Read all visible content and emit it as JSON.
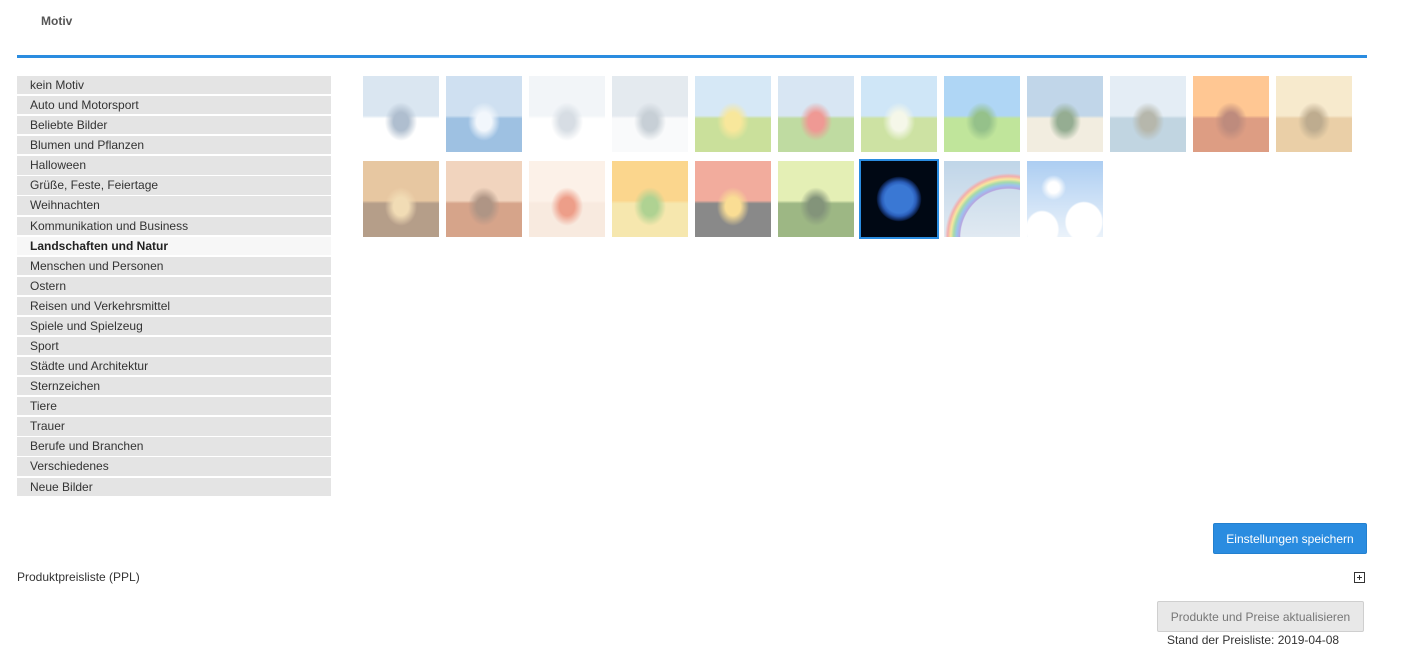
{
  "tab": {
    "title": "Motiv"
  },
  "categories": [
    "kein Motiv",
    "Auto und Motorsport",
    "Beliebte Bilder",
    "Blumen und Pflanzen",
    "Halloween",
    "Grüße, Feste, Feiertage",
    "Weihnachten",
    "Kommunikation und Business",
    "Landschaften und Natur",
    "Menschen und Personen",
    "Ostern",
    "Reisen und Verkehrsmittel",
    "Spiele und Spielzeug",
    "Sport",
    "Städte und Architektur",
    "Sternzeichen",
    "Tiere",
    "Trauer",
    "Berufe und Branchen",
    "Verschiedenes",
    "Neue Bilder"
  ],
  "active_category": "Landschaften und Natur",
  "motifs": [
    {
      "name": "snowy-mountain-lake",
      "sky": "#bcd2e6",
      "ground": "#ffffff",
      "accent": "#6f8aa8"
    },
    {
      "name": "blue-mountain-lake",
      "sky": "#a9c8e6",
      "ground": "#4f8fcc",
      "accent": "#e8f1fa"
    },
    {
      "name": "winter-gazebo",
      "sky": "#e8eef4",
      "ground": "#ffffff",
      "accent": "#b7c3cf"
    },
    {
      "name": "snowy-field-trees",
      "sky": "#cfd9e3",
      "ground": "#f5f7f9",
      "accent": "#9aa9b5"
    },
    {
      "name": "hat-in-flower-meadow",
      "sky": "#b6d6ef",
      "ground": "#9fc84a",
      "accent": "#f4d54b"
    },
    {
      "name": "poppy-field",
      "sky": "#b9d3ea",
      "ground": "#8cbf55",
      "accent": "#e2463d"
    },
    {
      "name": "blossom-tree-path",
      "sky": "#a8d2f2",
      "ground": "#a5cc59",
      "accent": "#eef2d8"
    },
    {
      "name": "green-tree-road",
      "sky": "#6fb6ee",
      "ground": "#8dd04a",
      "accent": "#3f8f2b"
    },
    {
      "name": "tropical-beach",
      "sky": "#8fb6d8",
      "ground": "#e9e0c8",
      "accent": "#3f6b3a"
    },
    {
      "name": "coastal-cliff",
      "sky": "#cfe0ee",
      "ground": "#8fb3c9",
      "accent": "#7b7d69"
    },
    {
      "name": "desert-sunset-cactus",
      "sky": "#ff9a3c",
      "ground": "#c24e1f",
      "accent": "#8a2e14"
    },
    {
      "name": "desert-dunes-palm",
      "sky": "#f2d9a6",
      "ground": "#d9a960",
      "accent": "#8a6a35"
    },
    {
      "name": "autumn-forest",
      "sky": "#d59a55",
      "ground": "#7a4f2a",
      "accent": "#e7c079"
    },
    {
      "name": "autumn-trees",
      "sky": "#e6b28a",
      "ground": "#b65a2c",
      "accent": "#6e3f22"
    },
    {
      "name": "maple-leaf-reflection",
      "sky": "#fbe7d6",
      "ground": "#f3d9c6",
      "accent": "#e0502a"
    },
    {
      "name": "sun-tree-field",
      "sky": "#f8b531",
      "ground": "#f0d56c",
      "accent": "#6fae3a"
    },
    {
      "name": "birds-sunset",
      "sky": "#e86a4e",
      "ground": "#2a2a2a",
      "accent": "#f6c23e"
    },
    {
      "name": "green-sunset-tree",
      "sky": "#cfe37a",
      "ground": "#4e7d21",
      "accent": "#1f3d0f"
    },
    {
      "name": "earth-globe",
      "sky": "#000814",
      "ground": "#0a1f4a",
      "accent": "#3a78d4"
    },
    {
      "name": "rainbow-sky",
      "sky": "#8db4d6",
      "ground": "#c9d9e8",
      "accent": "#e96b6b"
    },
    {
      "name": "sun-clouds-sky",
      "sky": "#6aa6e8",
      "ground": "#dbe9f7",
      "accent": "#ffffff"
    }
  ],
  "selected_motif": "earth-globe",
  "buttons": {
    "save": "Einstellungen speichern",
    "update": "Produkte und Preise aktualisieren"
  },
  "ppl": {
    "label": "Produktpreisliste (PPL)"
  },
  "stand": "Stand der Preisliste: 2019-04-08",
  "icons": {
    "expand": "plus-square-icon"
  },
  "colors": {
    "accent": "#2a8ce0"
  }
}
